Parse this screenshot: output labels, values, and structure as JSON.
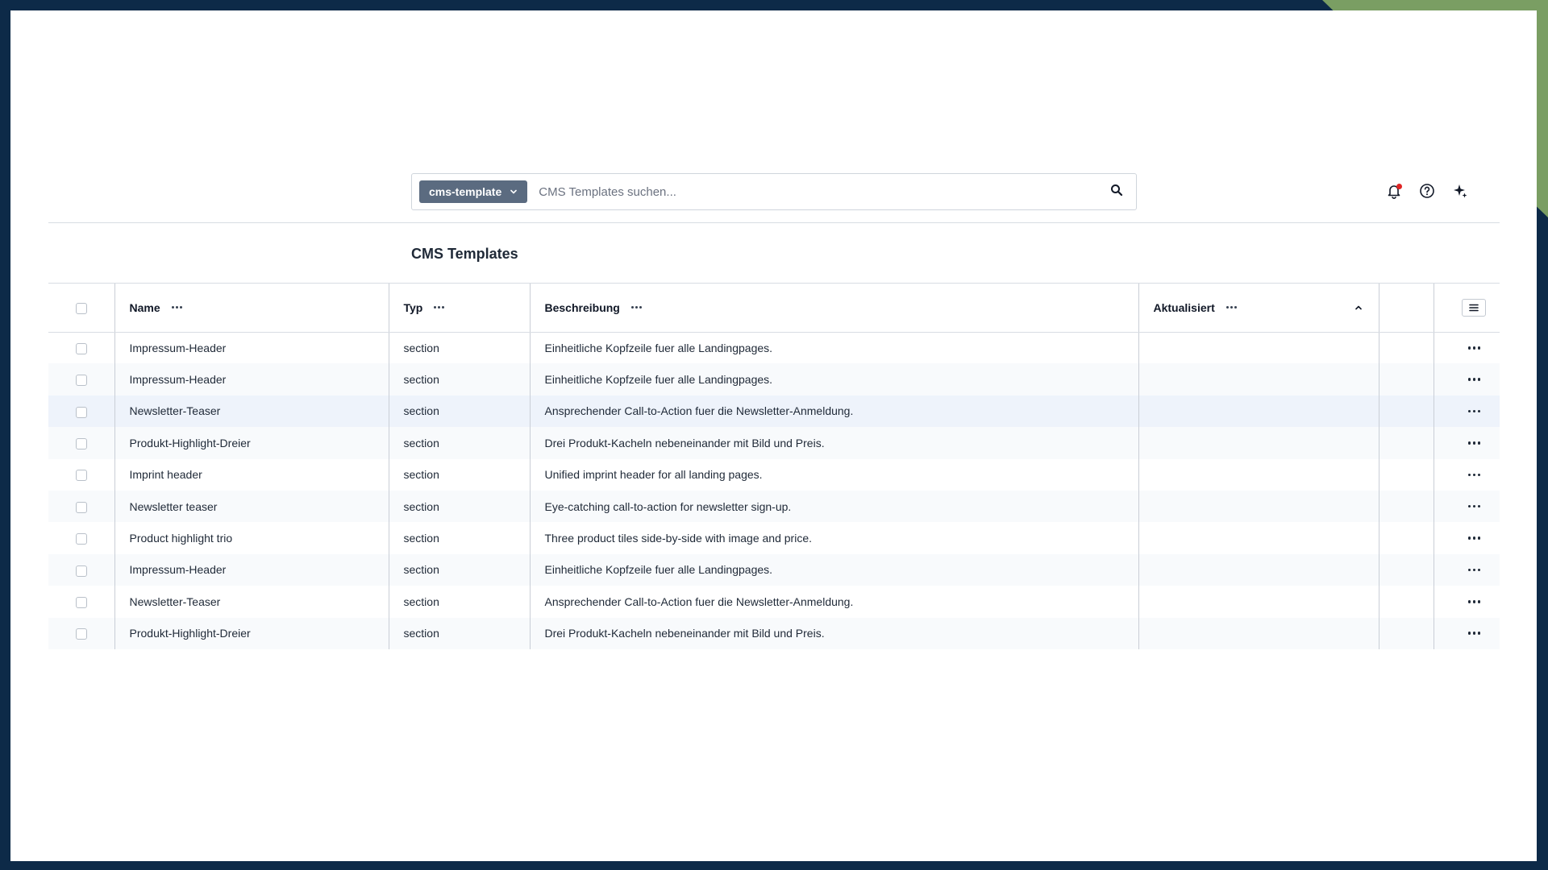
{
  "search": {
    "scope_label": "cms-template",
    "placeholder": "CMS Templates suchen..."
  },
  "page": {
    "title": "CMS Templates"
  },
  "table": {
    "columns": {
      "name": "Name",
      "type": "Typ",
      "description": "Beschreibung",
      "updated": "Aktualisiert"
    },
    "rows": [
      {
        "name": "Impressum-Header",
        "type": "section",
        "description": "Einheitliche Kopfzeile fuer alle Landingpages.",
        "updated": ""
      },
      {
        "name": "Impressum-Header",
        "type": "section",
        "description": "Einheitliche Kopfzeile fuer alle Landingpages.",
        "updated": ""
      },
      {
        "name": "Newsletter-Teaser",
        "type": "section",
        "description": "Ansprechender Call-to-Action fuer die Newsletter-Anmeldung.",
        "updated": ""
      },
      {
        "name": "Produkt-Highlight-Dreier",
        "type": "section",
        "description": "Drei Produkt-Kacheln nebeneinander mit Bild und Preis.",
        "updated": ""
      },
      {
        "name": "Imprint header",
        "type": "section",
        "description": "Unified imprint header for all landing pages.",
        "updated": ""
      },
      {
        "name": "Newsletter teaser",
        "type": "section",
        "description": "Eye-catching call-to-action for newsletter sign-up.",
        "updated": ""
      },
      {
        "name": "Product highlight trio",
        "type": "section",
        "description": "Three product tiles side-by-side with image and price.",
        "updated": ""
      },
      {
        "name": "Impressum-Header",
        "type": "section",
        "description": "Einheitliche Kopfzeile fuer alle Landingpages.",
        "updated": ""
      },
      {
        "name": "Newsletter-Teaser",
        "type": "section",
        "description": "Ansprechender Call-to-Action fuer die Newsletter-Anmeldung.",
        "updated": ""
      },
      {
        "name": "Produkt-Highlight-Dreier",
        "type": "section",
        "description": "Drei Produkt-Kacheln nebeneinander mit Bild und Preis.",
        "updated": ""
      }
    ]
  },
  "colors": {
    "background": "#0d2a48",
    "accent_green": "#7a9e63",
    "scope_button": "#5b6b80",
    "notification_dot": "#e02424",
    "row_highlight": "#eef3fb"
  },
  "icons": [
    "chevron-down-icon",
    "search-icon",
    "bell-icon",
    "help-icon",
    "sparkles-icon",
    "more-horizontal-icon",
    "chevron-up-icon",
    "menu-icon"
  ]
}
